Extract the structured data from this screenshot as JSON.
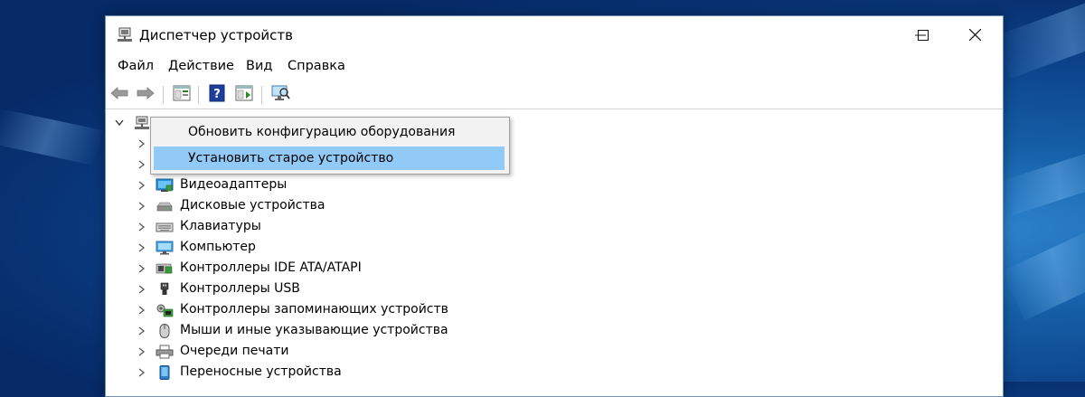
{
  "window": {
    "title": "Диспетчер устройств",
    "controls": {
      "minimize": "—",
      "maximize": "☐",
      "close": "✕"
    }
  },
  "menu": [
    "Файл",
    "Действие",
    "Вид",
    "Справка"
  ],
  "toolbar": [
    {
      "icon": "back-arrow-icon"
    },
    {
      "icon": "forward-arrow-icon"
    },
    {
      "icon": "properties-icon"
    },
    {
      "icon": "help-icon"
    },
    {
      "icon": "update-driver-icon"
    },
    {
      "icon": "scan-hardware-icon"
    }
  ],
  "context_menu": {
    "items": [
      {
        "label": "Обновить конфигурацию оборудования",
        "highlighted": false
      },
      {
        "label": "Установить старое устройство",
        "highlighted": true
      }
    ]
  },
  "tree": {
    "root_expanded": true,
    "items": [
      {
        "label": "",
        "icon": "generic-device-icon"
      },
      {
        "label": "",
        "icon": "generic-device-icon"
      },
      {
        "label": "Видеоадаптеры",
        "icon": "display-adapter-icon"
      },
      {
        "label": "Дисковые устройства",
        "icon": "disk-drive-icon"
      },
      {
        "label": "Клавиатуры",
        "icon": "keyboard-icon"
      },
      {
        "label": "Компьютер",
        "icon": "computer-icon"
      },
      {
        "label": "Контроллеры IDE ATA/ATAPI",
        "icon": "ide-controller-icon"
      },
      {
        "label": "Контроллеры USB",
        "icon": "usb-icon"
      },
      {
        "label": "Контроллеры запоминающих устройств",
        "icon": "storage-controller-icon"
      },
      {
        "label": "Мыши и иные указывающие устройства",
        "icon": "mouse-icon"
      },
      {
        "label": "Очереди печати",
        "icon": "printer-icon"
      },
      {
        "label": "Переносные устройства",
        "icon": "portable-device-icon"
      }
    ]
  },
  "colors": {
    "desktop": "#0b3f86",
    "highlight": "#91c9f7",
    "menu_bg": "#f2f2f2"
  }
}
